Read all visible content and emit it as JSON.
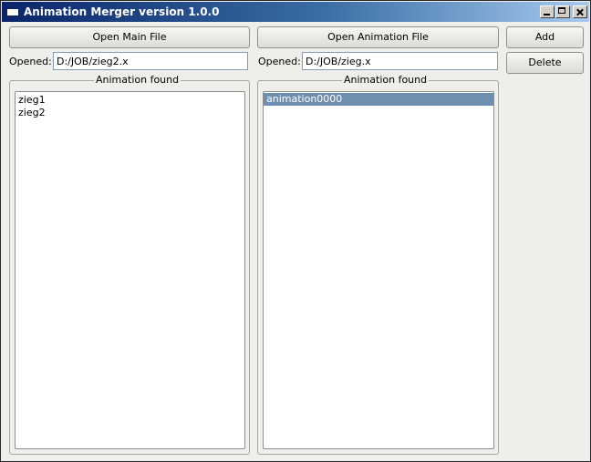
{
  "window": {
    "title": "Animation Merger version 1.0.0"
  },
  "left_panel": {
    "open_button": "Open Main File",
    "opened_label": "Opened:",
    "opened_value": "D:/JOB/zieg2.x",
    "group_title": "Animation found",
    "items": [
      "zieg1",
      "zieg2"
    ]
  },
  "right_panel": {
    "open_button": "Open Animation File",
    "opened_label": "Opened:",
    "opened_value": "D:/JOB/zieg.x",
    "group_title": "Animation found",
    "items": [
      "animation0000"
    ],
    "selected_index": 0
  },
  "actions": {
    "add": "Add",
    "delete": "Delete"
  },
  "colors": {
    "titlebar_start": "#0a246a",
    "titlebar_end": "#a6caf0",
    "selection": "#6f8fb0"
  }
}
